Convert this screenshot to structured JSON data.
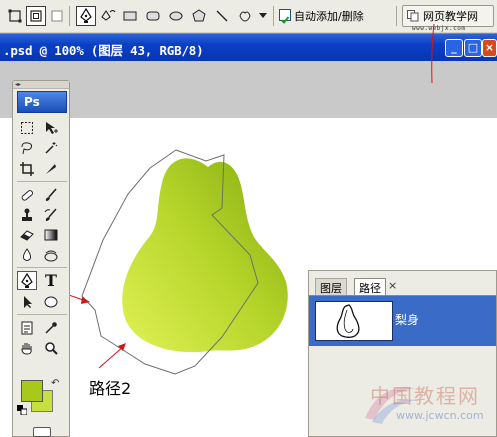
{
  "options_bar": {
    "auto_add_delete_label": "自动添加/删除",
    "auto_add_delete_checked": true,
    "site_button_label": "网页教学网",
    "site_url": "www.webjx.com"
  },
  "document": {
    "title": ".psd @ 100% (图层 43, RGB/8)"
  },
  "toolbox": {
    "logo": "Ps",
    "foreground_color": "#a8c81c",
    "background_color": "#c7e03e",
    "tools": [
      "marquee-icon",
      "move-icon",
      "lasso-icon",
      "magic-wand-icon",
      "crop-icon",
      "slice-icon",
      "healing-brush-icon",
      "brush-icon",
      "clone-stamp-icon",
      "history-brush-icon",
      "eraser-icon",
      "gradient-icon",
      "blur-icon",
      "dodge-icon",
      "pen-icon",
      "type-icon",
      "path-select-icon",
      "shape-icon",
      "notes-icon",
      "eyedropper-icon",
      "hand-icon",
      "zoom-icon"
    ],
    "type_tool_glyph": "T"
  },
  "panel": {
    "tab_layers": "图层",
    "tab_paths": "路径",
    "tab_close": "×",
    "path_name": "梨身"
  },
  "annotation": {
    "label": "路径2"
  },
  "watermark": {
    "text": "中国教程网",
    "url": "www.jcwcn.com"
  },
  "colors": {
    "pear_light": "#d8ec4c",
    "pear_dark": "#8fb515",
    "arrow": "#d01818",
    "title_bar": "#0a3fc4",
    "selection": "#3a6cc7"
  }
}
